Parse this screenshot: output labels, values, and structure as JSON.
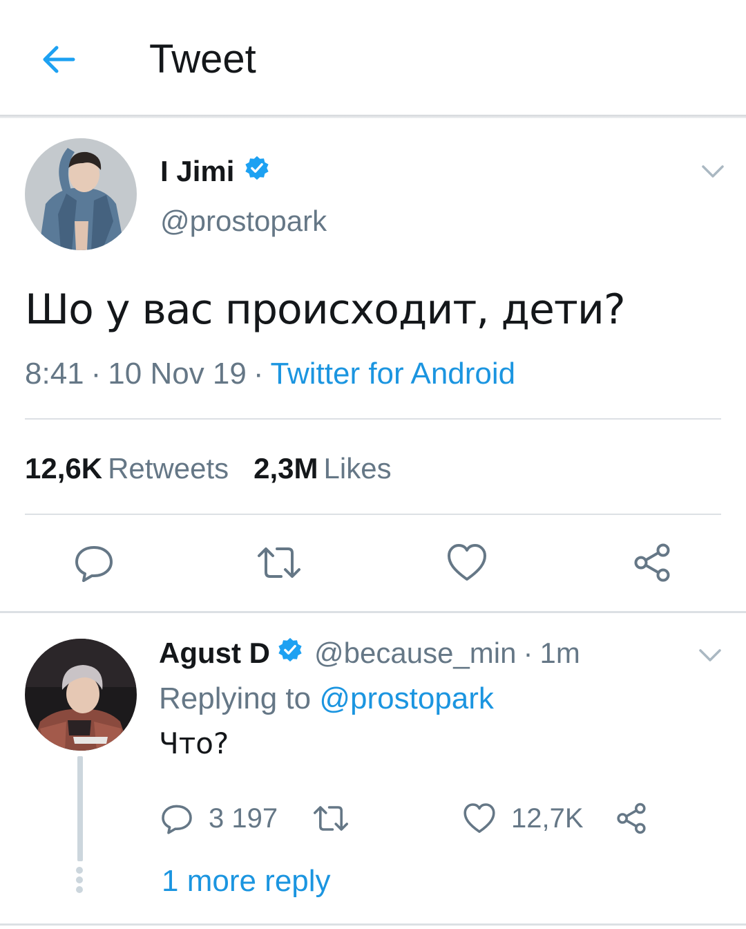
{
  "header": {
    "title": "Tweet",
    "back_icon": "arrow-left-icon"
  },
  "colors": {
    "accent": "#1DA1F2",
    "link": "#1B95E0",
    "secondary_text": "#657786",
    "primary_text": "#14171A",
    "divider": "#DCE0E4"
  },
  "tweet": {
    "display_name": "I Jimi",
    "handle": "@prostopark",
    "verified": true,
    "text": "Шо у вас происходит, дети?",
    "time": "8:41",
    "date": "10 Nov 19",
    "separator": "·",
    "source": "Twitter for Android",
    "retweets_count": "12,6K",
    "retweets_label": "Retweets",
    "likes_count": "2,3M",
    "likes_label": "Likes",
    "actions": [
      "reply-icon",
      "retweet-icon",
      "like-icon",
      "share-icon"
    ]
  },
  "reply": {
    "display_name": "Agust D",
    "handle": "@because_min",
    "separator": "·",
    "time": "1m",
    "verified": true,
    "replying_prefix": "Replying to",
    "replying_to": "@prostopark",
    "text": "Что?",
    "reply_count": "3 197",
    "like_count": "12,7K",
    "more_replies": "1 more reply"
  }
}
